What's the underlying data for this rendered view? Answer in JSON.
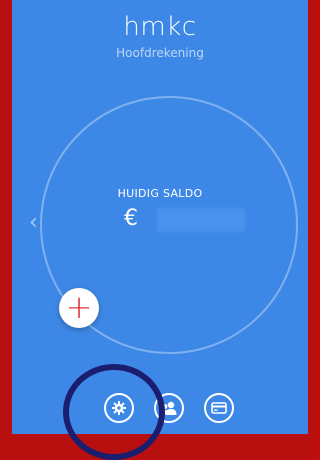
{
  "header": {
    "title": "hmkc",
    "subtitle": "Hoofdrekening"
  },
  "balance": {
    "label": "HUIDIG SALDO",
    "currency_symbol": "€"
  },
  "actions": {
    "add_glyph": "+"
  },
  "bottom_nav": {
    "items": [
      {
        "icon": "gear-icon"
      },
      {
        "icon": "people-icon"
      },
      {
        "icon": "card-icon"
      }
    ]
  },
  "colors": {
    "screen_bg": "#3d88e6",
    "frame": "#b80f0f",
    "highlight_ring": "#1b1e6e",
    "add_icon": "#e33434"
  }
}
